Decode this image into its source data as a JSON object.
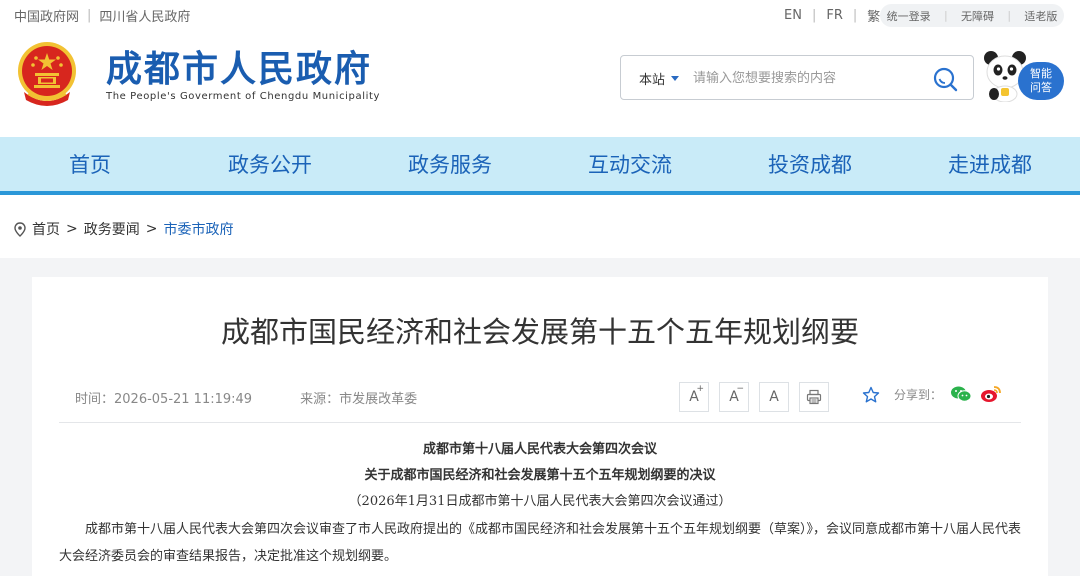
{
  "topbar": {
    "link1": "中国政府网",
    "link2": "四川省人民政府",
    "lang_en": "EN",
    "lang_fr": "FR",
    "lang_tc": "繁",
    "login": "统一登录",
    "accessibility": "无障碍",
    "elder": "适老版"
  },
  "header": {
    "title": "成都市人民政府",
    "subtitle": "The People's  Goverment of Chengdu Municipality"
  },
  "search": {
    "scope": "本站",
    "placeholder": "请输入您想要搜索的内容"
  },
  "assistant": {
    "line1": "智能",
    "line2": "问答"
  },
  "nav": [
    "首页",
    "政务公开",
    "政务服务",
    "互动交流",
    "投资成都",
    "走进成都"
  ],
  "breadcrumb": {
    "home": "首页",
    "level2": "政务要闻",
    "current": "市委市政府"
  },
  "article": {
    "title": "成都市国民经济和社会发展第十五个五年规划纲要",
    "time": "时间：2026-05-21 11:19:49",
    "source": "来源：市发展改革委",
    "share_label": "分享到：",
    "font_a": "A",
    "heading1": "成都市第十八届人民代表大会第四次会议",
    "heading2": "关于成都市国民经济和社会发展第十五个五年规划纲要的决议",
    "heading3": "（2026年1月31日成都市第十八届人民代表大会第四次会议通过）",
    "para1": "成都市第十八届人民代表大会第四次会议审查了市人民政府提出的《成都市国民经济和社会发展第十五个五年规划纲要（草案）》，会议同意成都市第十八届人民代表大会经济委员会的审查结果报告，决定批准这个规划纲要。"
  },
  "colors": {
    "brand_blue": "#1a5db0",
    "nav_bg": "#c9ebf8",
    "nav_border": "#2a97d8",
    "emblem_red": "#d7261e",
    "emblem_gold": "#f2c233"
  }
}
